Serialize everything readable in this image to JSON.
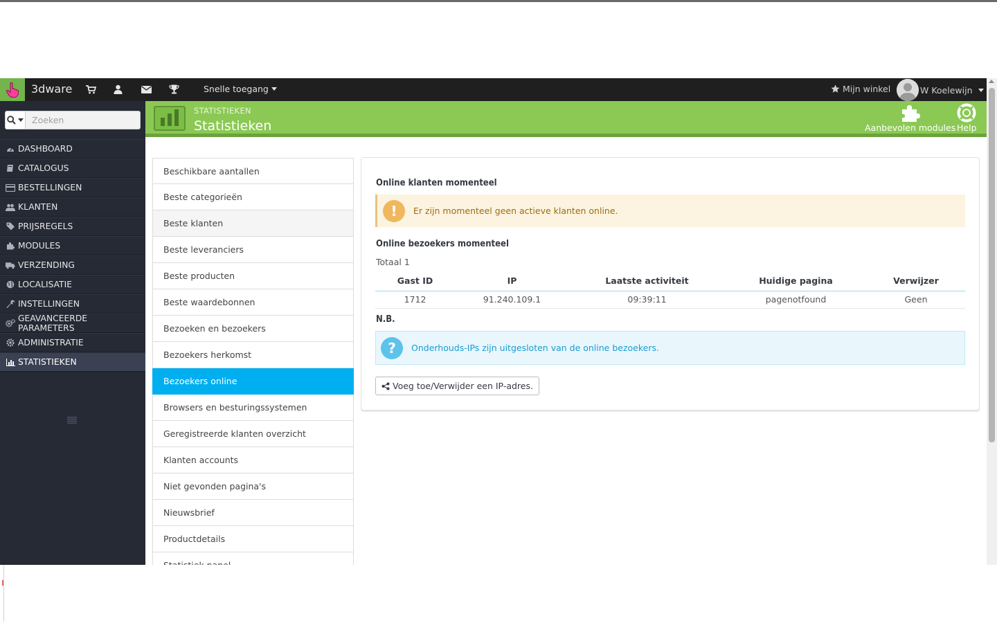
{
  "header": {
    "shop_name": "3dware",
    "quick_access": "Snelle toegang",
    "my_shop": "Mijn winkel",
    "user_name": "W Koelewijn",
    "icons": [
      "cart-icon",
      "user-icon",
      "envelope-icon",
      "trophy-icon"
    ]
  },
  "sidebar": {
    "search_placeholder": "Zoeken",
    "items": [
      {
        "label": "DASHBOARD",
        "icon": "dashboard-icon"
      },
      {
        "label": "CATALOGUS",
        "icon": "book-icon"
      },
      {
        "label": "BESTELLINGEN",
        "icon": "credit-card-icon"
      },
      {
        "label": "KLANTEN",
        "icon": "users-icon"
      },
      {
        "label": "PRIJSREGELS",
        "icon": "tags-icon"
      },
      {
        "label": "MODULES",
        "icon": "puzzle-icon"
      },
      {
        "label": "VERZENDING",
        "icon": "truck-icon"
      },
      {
        "label": "LOCALISATIE",
        "icon": "globe-icon"
      },
      {
        "label": "INSTELLINGEN",
        "icon": "wrench-icon"
      },
      {
        "label": "GEAVANCEERDE PARAMETERS",
        "icon": "cogs-icon"
      },
      {
        "label": "ADMINISTRATIE",
        "icon": "cog-icon"
      },
      {
        "label": "STATISTIEKEN",
        "icon": "bar-chart-icon"
      }
    ]
  },
  "pagehead": {
    "breadcrumb": "STATISTIEKEN",
    "title": "Statistieken",
    "recommended_modules": "Aanbevolen modules",
    "help": "Help"
  },
  "stats_menu": [
    "Beschikbare aantallen",
    "Beste categorieën",
    "Beste klanten",
    "Beste leveranciers",
    "Beste producten",
    "Beste waardebonnen",
    "Bezoeken en bezoekers",
    "Bezoekers herkomst",
    "Bezoekers online",
    "Browsers en besturingssystemen",
    "Geregistreerde klanten overzicht",
    "Klanten accounts",
    "Niet gevonden pagina's",
    "Nieuwsbrief",
    "Productdetails",
    "Statistiek panel"
  ],
  "panel": {
    "customers_title": "Online klanten momenteel",
    "customers_warning": "Er zijn momenteel geen actieve klanten online.",
    "visitors_title": "Online bezoekers momenteel",
    "total": "Totaal 1",
    "columns": [
      "Gast ID",
      "IP",
      "Laatste activiteit",
      "Huidige pagina",
      "Verwijzer"
    ],
    "rows": [
      [
        "1712",
        "91.240.109.1",
        "09:39:11",
        "pagenotfound",
        "Geen"
      ]
    ],
    "nb_title": "N.B.",
    "nb_info": "Onderhouds-IPs zijn uitgesloten van de online bezoekers.",
    "ip_button": "Voeg toe/Verwijder een IP-adres."
  },
  "colors": {
    "header_bg": "#1f1f1f",
    "sidebar_bg": "#252a35",
    "pagehead_green": "#8bc954",
    "active_blue": "#00aff0"
  }
}
